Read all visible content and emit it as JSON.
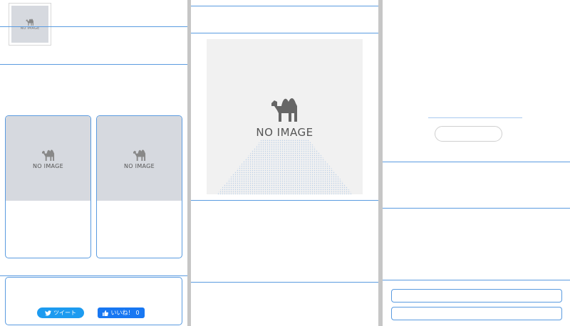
{
  "placeholder": {
    "label": "NO IMAGE",
    "icon": "camel-icon"
  },
  "share": {
    "tweet_label": "ツイート",
    "like_label": "いいね！",
    "like_count": "0"
  },
  "colors": {
    "accent": "#5a9be0",
    "twitter": "#1d9bf0",
    "facebook": "#1877f2",
    "placeholder_bg": "#d6d9df",
    "gutter": "#c6c6c6"
  }
}
